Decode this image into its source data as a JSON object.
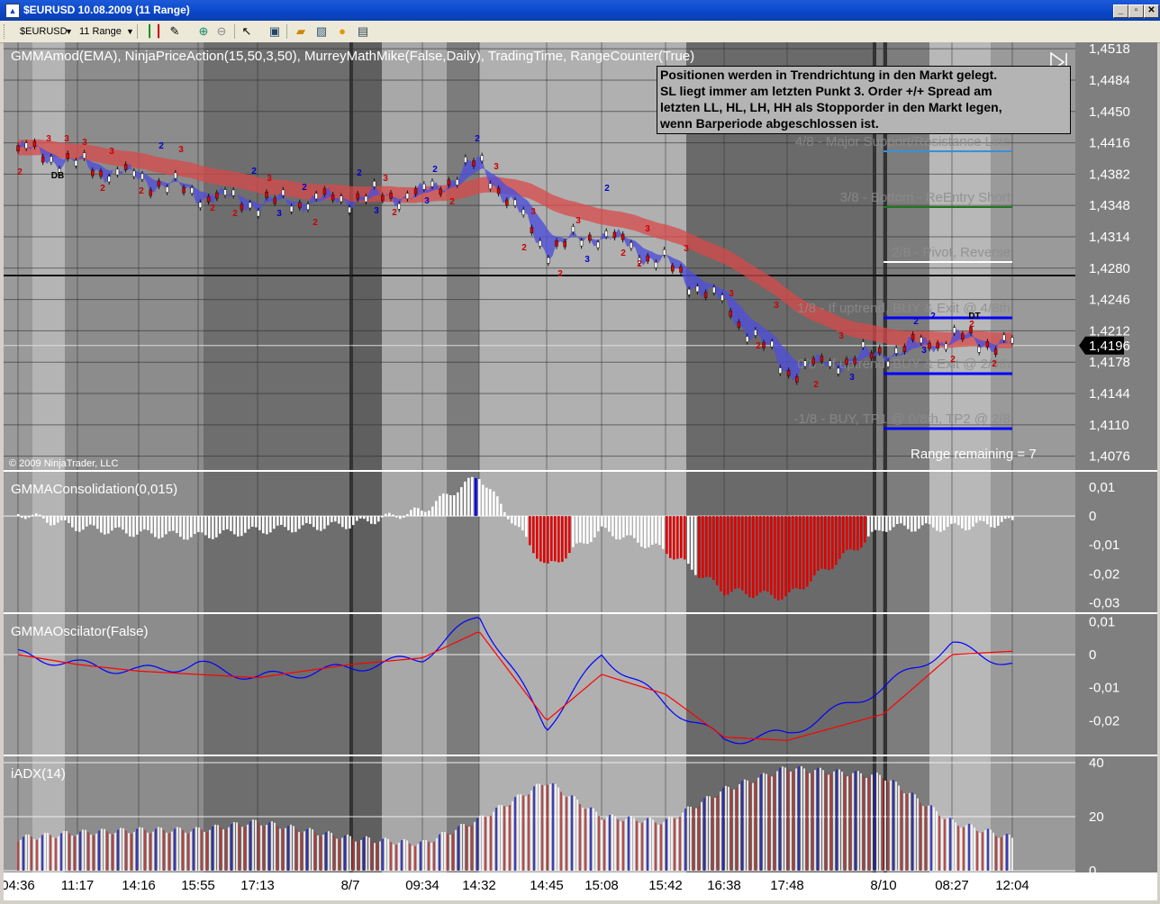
{
  "window": {
    "title": "$EURUSD  10.08.2009 (11 Range)",
    "buttons": [
      "_",
      "▫",
      "✕"
    ]
  },
  "toolbar": {
    "instrument": "$EURUSD",
    "period": "11 Range"
  },
  "panels": {
    "price": {
      "indicator_title": "GMMAmod(EMA), NinjaPriceAction(15,50,3,50), MurreyMathMike(False,Daily), TradingTime, RangeCounter(True)",
      "y_labels": [
        "1,4518",
        "1,4484",
        "1,4450",
        "1,4416",
        "1,4382",
        "1,4348",
        "1,4314",
        "1,4280",
        "1,4246",
        "1,4212",
        "1,4178",
        "1,4144",
        "1,4110",
        "1,4076"
      ],
      "current_price": "1,4196",
      "copyright": "© 2009 NinjaTrader, LLC",
      "range_remaining": "Range remaining = 7",
      "murrey_lines": [
        {
          "label": "4/8 - Major Support/Resistance Line",
          "color": "#3a8fd8"
        },
        {
          "label": "3/8 - Bottom - ReEntry Short",
          "color": "#1e7a1e"
        },
        {
          "label": "2/8 - Pivot, Reverse",
          "color": "#ffffff"
        },
        {
          "label": "1/8 - If uptrend, BUY & Exit @ 4/8th",
          "color": "#0000ff"
        },
        {
          "label": "0/8 - If uptrend, BUY & Exit @ 2/8th",
          "color": "#0000ff"
        },
        {
          "label": "-1/8 - BUY, TP1 @ 0/8th, TP2 @ 2/8",
          "color": "#0000ff"
        }
      ],
      "note": "Positionen werden in Trendrichtung in den Markt gelegt.\nSL liegt immer am letzten Punkt 3. Order +/+ Spread am letzten LL, HL, LH, HH als Stopporder in den Markt legen, wenn Barperiode abgeschlossen ist.",
      "note_lines": [
        "Positionen werden in Trendrichtung in den Markt gelegt.",
        "SL liegt immer am letzten Punkt 3. Order +/+ Spread am",
        "letzten LL, HL, LH, HH als Stopporder in den Markt legen,",
        "wenn Barperiode abgeschlossen ist."
      ],
      "pattern_labels": [
        "DB",
        "DT"
      ]
    },
    "consolidation": {
      "title": "GMMAConsolidation(0,015)",
      "y_labels": [
        "0,01",
        "0",
        "-0,01",
        "-0,02",
        "-0,03"
      ]
    },
    "oscillator": {
      "title": "GMMAOscilator(False)",
      "y_labels": [
        "0,01",
        "0",
        "-0,01",
        "-0,02"
      ]
    },
    "adx": {
      "title": "iADX(14)",
      "y_labels": [
        "40",
        "20",
        "0"
      ]
    }
  },
  "x_labels": [
    "04:36",
    "11:17",
    "14:16",
    "15:55",
    "17:13",
    "8/7",
    "09:34",
    "14:32",
    "14:45",
    "15:08",
    "15:42",
    "16:38",
    "17:48",
    "8/10",
    "08:27",
    "12:04"
  ],
  "chart_data": [
    {
      "type": "line",
      "title": "GMMAmod(EMA), NinjaPriceAction(15,50,3,50), MurreyMathMike(False,Daily), TradingTime, RangeCounter(True)",
      "categories": [
        "04:36",
        "11:17",
        "14:16",
        "15:55",
        "17:13",
        "8/7",
        "09:34",
        "14:32",
        "14:45",
        "15:08",
        "15:42",
        "16:38",
        "17:48",
        "8/10",
        "08:27",
        "12:04"
      ],
      "series": [
        {
          "values": [
            1.441,
            1.4392,
            1.4378,
            1.436,
            1.435,
            1.4356,
            1.436,
            1.4395,
            1.43,
            1.4318,
            1.4284,
            1.424,
            1.4168,
            1.4188,
            1.4205,
            1.4196
          ]
        }
      ],
      "ylim": [
        1.406,
        1.4525
      ],
      "current_value": 1.4196
    },
    {
      "type": "bar",
      "title": "GMMAConsolidation(0,015)",
      "categories": [
        "04:36",
        "11:17",
        "14:16",
        "15:55",
        "17:13",
        "8/7",
        "09:34",
        "14:32",
        "14:45",
        "15:08",
        "15:42",
        "16:38",
        "17:48",
        "8/10",
        "08:27",
        "12:04"
      ],
      "values": [
        0.001,
        -0.004,
        -0.006,
        -0.007,
        -0.005,
        -0.003,
        0.002,
        0.014,
        -0.018,
        -0.005,
        -0.012,
        -0.026,
        -0.028,
        -0.004,
        -0.004,
        -0.002
      ],
      "ylim": [
        -0.033,
        0.015
      ]
    },
    {
      "type": "line",
      "title": "GMMAOscilator(False)",
      "categories": [
        "04:36",
        "11:17",
        "14:16",
        "15:55",
        "17:13",
        "8/7",
        "09:34",
        "14:32",
        "14:45",
        "15:08",
        "15:42",
        "16:38",
        "17:48",
        "8/10",
        "08:27",
        "12:04"
      ],
      "series": [
        {
          "color": "#0000ff",
          "values": [
            0.0,
            -0.003,
            -0.005,
            -0.003,
            -0.007,
            -0.004,
            -0.001,
            0.012,
            -0.022,
            0.0,
            -0.015,
            -0.026,
            -0.024,
            -0.01,
            0.003,
            -0.003
          ]
        },
        {
          "color": "#ff0000",
          "values": [
            0.0,
            -0.003,
            -0.005,
            -0.006,
            -0.007,
            -0.003,
            -0.001,
            0.007,
            -0.02,
            -0.006,
            -0.012,
            -0.025,
            -0.026,
            -0.018,
            0.0,
            0.001
          ]
        }
      ],
      "ylim": [
        -0.03,
        0.012
      ]
    },
    {
      "type": "bar",
      "title": "iADX(14)",
      "categories": [
        "04:36",
        "11:17",
        "14:16",
        "15:55",
        "17:13",
        "8/7",
        "09:34",
        "14:32",
        "14:45",
        "15:08",
        "15:42",
        "16:38",
        "17:48",
        "8/10",
        "08:27",
        "12:04"
      ],
      "values": [
        12,
        14,
        15,
        15,
        18,
        12,
        10,
        19,
        33,
        20,
        18,
        30,
        38,
        35,
        18,
        12
      ],
      "ylim": [
        0,
        42
      ]
    }
  ]
}
